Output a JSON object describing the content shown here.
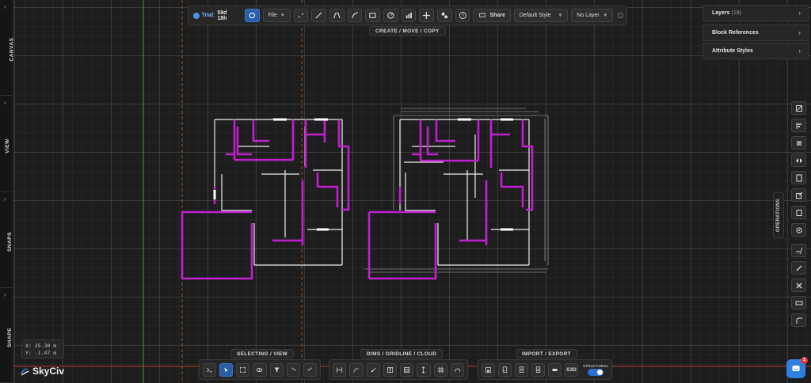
{
  "app": {
    "trial_label": "Trial:",
    "trial_remaining": "59d 18h",
    "file_menu": "File",
    "share_button": "Share",
    "style_select": "Default Style",
    "layer_select": "No Layer"
  },
  "toolbar_groups": {
    "top": "CREATE / MOVE / COPY",
    "selecting": "SELECTING / VIEW",
    "dims": "DIMS / GRIDLINE / CLOUD",
    "import": "IMPORT / EXPORT"
  },
  "left_tabs": [
    "CANVAS",
    "VIEW",
    "SNAPS",
    "SHAPE"
  ],
  "right_panel": {
    "layers_label": "Layers",
    "layers_count": "(18)",
    "block_refs_label": "Block References",
    "attr_styles_label": "Attribute Styles",
    "operations_label": "OPERATIONS"
  },
  "bottom": {
    "s3d_button": "S3D",
    "structural_label": "STRUCTURAL"
  },
  "coords": {
    "x": "X: 25.30 m",
    "y": "Y: -1.47 m"
  },
  "brand": "SkyCiv",
  "chat_badge": "1",
  "colors": {
    "accent": "#2f7fe0",
    "wall_magenta": "#c21fd1",
    "line_white": "#eeeeee",
    "axis_green": "#2faa2f",
    "axis_red": "#c0392b",
    "guide_orange": "#b8681e"
  }
}
